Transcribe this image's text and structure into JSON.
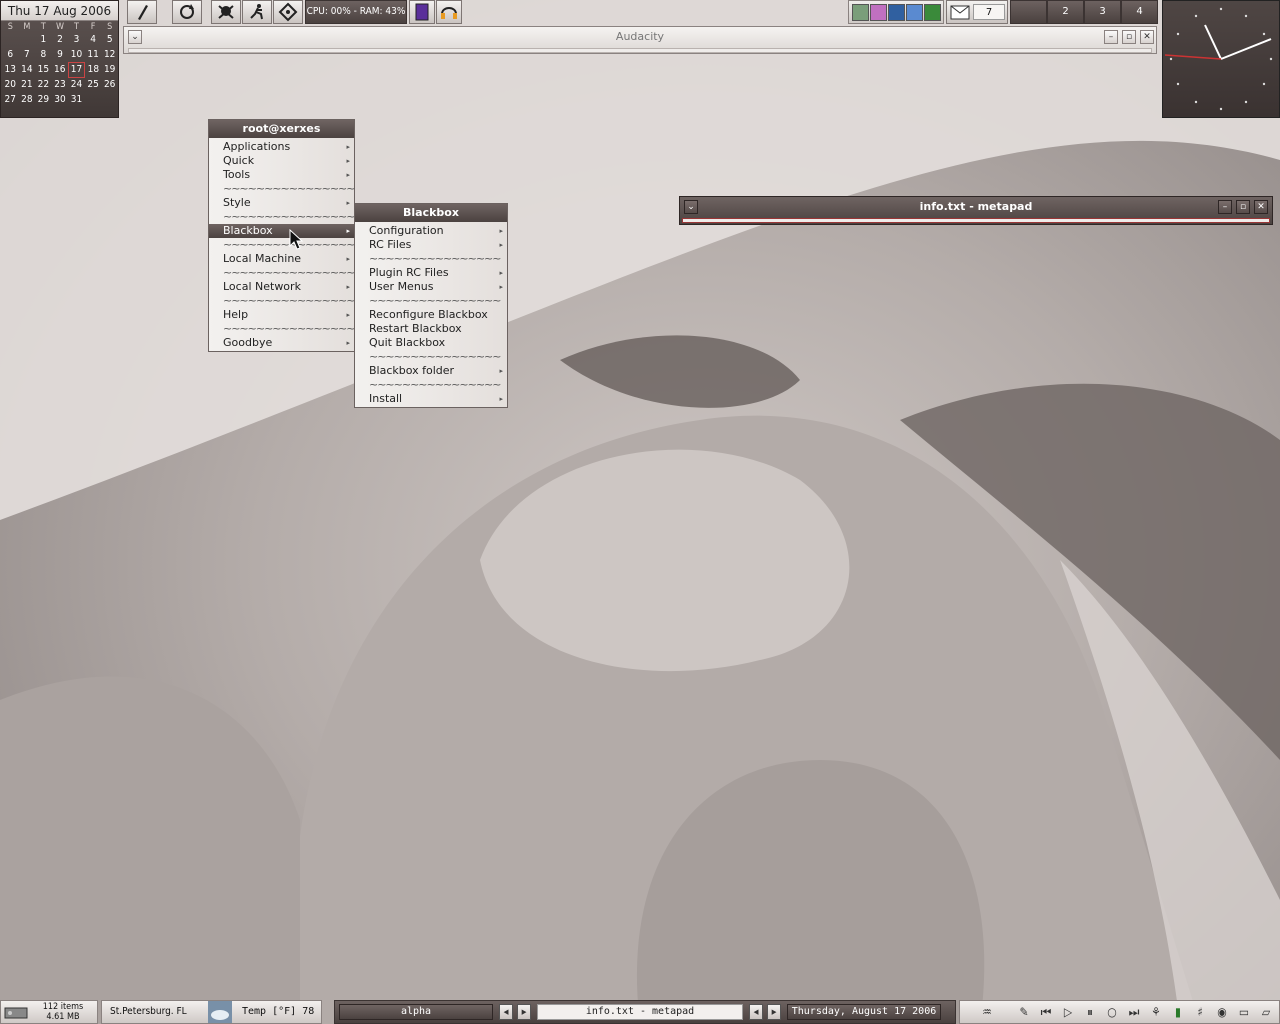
{
  "calendar": {
    "header": "Thu 17 Aug 2006",
    "dows": [
      "S",
      "M",
      "T",
      "W",
      "T",
      "F",
      "S"
    ],
    "weeks": [
      [
        "",
        "",
        "1",
        "2",
        "3",
        "4",
        "5"
      ],
      [
        "6",
        "7",
        "8",
        "9",
        "10",
        "11",
        "12"
      ],
      [
        "13",
        "14",
        "15",
        "16",
        "17",
        "18",
        "19"
      ],
      [
        "20",
        "21",
        "22",
        "23",
        "24",
        "25",
        "26"
      ],
      [
        "27",
        "28",
        "29",
        "30",
        "31",
        "",
        ""
      ]
    ],
    "today": "17"
  },
  "toolbar": {
    "buttons": [
      "pen-icon",
      "refresh-icon",
      "skull-icon",
      "runner-icon",
      "recycle-icon"
    ],
    "cpu_ram": "CPU: 00% - RAM: 43%",
    "mail_count": "7",
    "workspaces": [
      "",
      "2",
      "3",
      "4"
    ]
  },
  "windows": {
    "audacity": {
      "title": "Audacity"
    },
    "metapad": {
      "title": "info.txt - metapad"
    }
  },
  "root_menu": {
    "title": "root@xerxes",
    "items": [
      {
        "label": "Applications",
        "submenu": true
      },
      {
        "label": "Quick",
        "submenu": true
      },
      {
        "label": "Tools",
        "submenu": true
      },
      {
        "label": "~~~~~~~~~~~~~~~~",
        "sep": true
      },
      {
        "label": "Style",
        "submenu": true
      },
      {
        "label": "~~~~~~~~~~~~~~~~",
        "sep": true
      },
      {
        "label": "Blackbox",
        "submenu": true,
        "active": true
      },
      {
        "label": "~~~~~~~~~~~~~~~~",
        "sep": true
      },
      {
        "label": "Local Machine",
        "submenu": true
      },
      {
        "label": "~~~~~~~~~~~~~~~~",
        "sep": true
      },
      {
        "label": "Local Network",
        "submenu": true
      },
      {
        "label": "~~~~~~~~~~~~~~~~",
        "sep": true
      },
      {
        "label": "Help",
        "submenu": true
      },
      {
        "label": "~~~~~~~~~~~~~~~~",
        "sep": true
      },
      {
        "label": "Goodbye",
        "submenu": true
      }
    ]
  },
  "blackbox_menu": {
    "title": "Blackbox",
    "items": [
      {
        "label": "Configuration",
        "submenu": true
      },
      {
        "label": "RC Files",
        "submenu": true
      },
      {
        "label": "~~~~~~~~~~~~~~~~",
        "sep": true
      },
      {
        "label": "Plugin RC Files",
        "submenu": true
      },
      {
        "label": "User Menus",
        "submenu": true
      },
      {
        "label": "~~~~~~~~~~~~~~~~",
        "sep": true
      },
      {
        "label": "Reconfigure Blackbox"
      },
      {
        "label": "Restart Blackbox"
      },
      {
        "label": "Quit Blackbox"
      },
      {
        "label": "~~~~~~~~~~~~~~~~",
        "sep": true
      },
      {
        "label": "Blackbox folder",
        "submenu": true
      },
      {
        "label": "~~~~~~~~~~~~~~~~",
        "sep": true
      },
      {
        "label": "Install",
        "submenu": true
      }
    ]
  },
  "taskbar": {
    "items_count": "112 items",
    "items_size": "4.61 MB",
    "location": "St.Petersburg. FL",
    "temp": "Temp [°F] 78",
    "workspace_name": "alpha",
    "active_task": "info.txt - metapad",
    "date": "Thursday, August 17 2006"
  },
  "colors": {
    "accent_dark": "#4b4240",
    "accent_red": "#c44444"
  }
}
